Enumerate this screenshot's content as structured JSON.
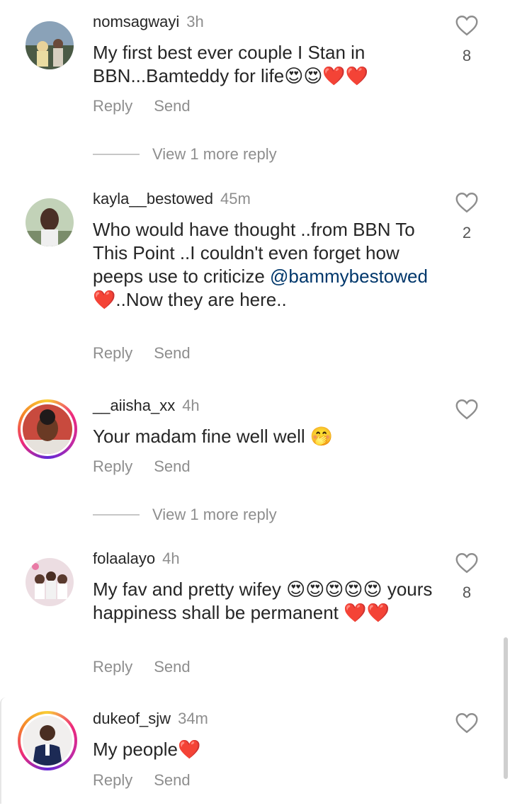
{
  "comments": [
    {
      "username": "nomsagwayi",
      "time": "3h",
      "text": "My first best ever couple I Stan in BBN...Bamteddy for life😍😍❤️❤️",
      "reply_label": "Reply",
      "send_label": "Send",
      "likes": "8",
      "more_replies": "View 1 more reply"
    },
    {
      "username": "kayla__bestowed",
      "time": "45m",
      "text_before": "Who would have thought ..from BBN To This Point ..I couldn't even forget how peeps use to criticize",
      "mention": "@bammybestowed",
      "text_after": " ❤️..Now they are here..",
      "reply_label": "Reply",
      "send_label": "Send",
      "likes": "2"
    },
    {
      "username": "__aiisha_xx",
      "time": "4h",
      "text": "Your madam fine well well 🤭",
      "reply_label": "Reply",
      "send_label": "Send",
      "more_replies": "View 1 more reply"
    },
    {
      "username": "folaalayo",
      "time": "4h",
      "text": "My fav and pretty wifey 😍😍😍😍😍 yours happiness shall be permanent ❤️❤️",
      "reply_label": "Reply",
      "send_label": "Send",
      "likes": "8"
    },
    {
      "username": "dukeof_sjw",
      "time": "34m",
      "text": "My people❤️",
      "reply_label": "Reply",
      "send_label": "Send"
    }
  ],
  "colors": {
    "text": "#262626",
    "secondary": "#8e8e8e",
    "mention": "#00376b",
    "story_ring": [
      "#f9ce34",
      "#ee2a7b",
      "#6228d7"
    ]
  },
  "icons": {
    "like": "heart-outline-icon"
  }
}
